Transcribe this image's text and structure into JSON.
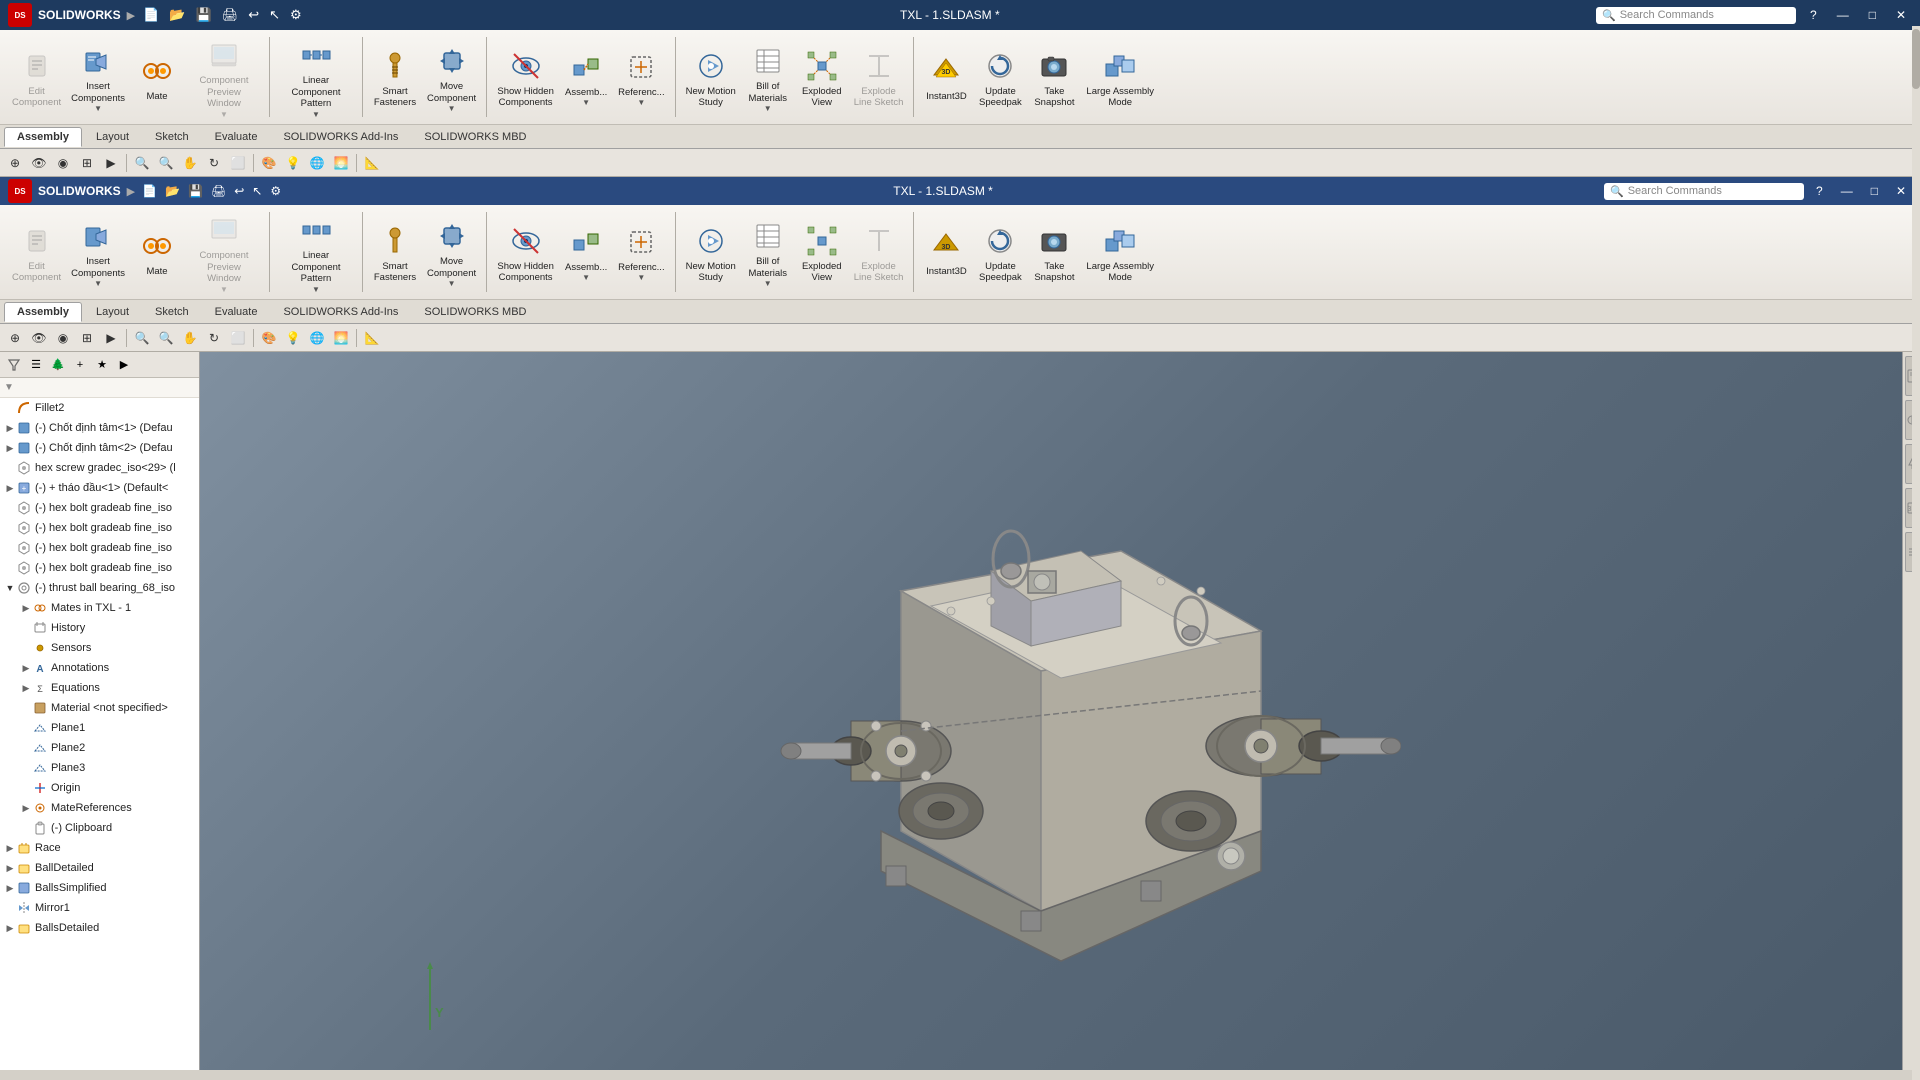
{
  "app": {
    "name": "SOLIDWORKS",
    "logo_text": "DS",
    "title": "TXL - 1.SLDASM *",
    "search_placeholder": "Search Commands",
    "window_controls": [
      "?",
      "—",
      "□",
      "✕"
    ]
  },
  "toolbar1": {
    "items": [
      {
        "id": "edit-component",
        "label": "Edit\nComponent",
        "icon": "edit",
        "disabled": true
      },
      {
        "id": "insert-components",
        "label": "Insert\nComponents",
        "icon": "insert",
        "disabled": false
      },
      {
        "id": "mate",
        "label": "Mate",
        "icon": "mate",
        "disabled": false
      },
      {
        "id": "component-preview",
        "label": "Component\nPreview Window",
        "icon": "preview",
        "disabled": true
      },
      {
        "id": "linear-pattern",
        "label": "Linear Component\nPattern",
        "icon": "pattern",
        "disabled": false
      },
      {
        "id": "smart-fasteners",
        "label": "Smart\nFasteners",
        "icon": "fastener",
        "disabled": false
      },
      {
        "id": "move-component",
        "label": "Move\nComponent",
        "icon": "move",
        "disabled": false
      },
      {
        "id": "show-hidden",
        "label": "Show Hidden\nComponents",
        "icon": "hidden",
        "disabled": false
      },
      {
        "id": "assembly",
        "label": "Assemb...",
        "icon": "assem",
        "disabled": false
      },
      {
        "id": "reference",
        "label": "Referenc...",
        "icon": "ref",
        "disabled": false
      },
      {
        "id": "new-motion-study",
        "label": "New Motion\nStudy",
        "icon": "motion",
        "disabled": false
      },
      {
        "id": "bill-of-materials",
        "label": "Bill of\nMaterials",
        "icon": "bom",
        "disabled": false
      },
      {
        "id": "exploded-view",
        "label": "Exploded\nView",
        "icon": "explode",
        "disabled": false
      },
      {
        "id": "explode-line",
        "label": "Explode\nLine Sketch",
        "icon": "explodeline",
        "disabled": true
      },
      {
        "id": "instant3d",
        "label": "Instant3D",
        "icon": "instant3d",
        "disabled": false
      },
      {
        "id": "update-speedpak",
        "label": "Update\nSpeedpak",
        "icon": "speedpak",
        "disabled": false
      },
      {
        "id": "take-snapshot",
        "label": "Take\nSnapshot",
        "icon": "snapshot",
        "disabled": false
      },
      {
        "id": "large-assembly",
        "label": "Large Assembly\nMode",
        "icon": "large",
        "disabled": false
      }
    ]
  },
  "tabs1": {
    "items": [
      {
        "id": "assembly-tab",
        "label": "Assembly",
        "active": true
      },
      {
        "id": "layout-tab",
        "label": "Layout",
        "active": false
      },
      {
        "id": "sketch-tab",
        "label": "Sketch",
        "active": false
      },
      {
        "id": "evaluate-tab",
        "label": "Evaluate",
        "active": false
      },
      {
        "id": "addins-tab",
        "label": "SOLIDWORKS Add-Ins",
        "active": false
      },
      {
        "id": "mbd-tab",
        "label": "SOLIDWORKS MBD",
        "active": false
      }
    ]
  },
  "tabs2": {
    "items": [
      {
        "id": "assembly-tab2",
        "label": "Assembly",
        "active": true
      },
      {
        "id": "layout-tab2",
        "label": "Layout",
        "active": false
      },
      {
        "id": "sketch-tab2",
        "label": "Sketch",
        "active": false
      },
      {
        "id": "evaluate-tab2",
        "label": "Evaluate",
        "active": false
      },
      {
        "id": "addins-tab2",
        "label": "SOLIDWORKS Add-Ins",
        "active": false
      },
      {
        "id": "mbd-tab2",
        "label": "SOLIDWORKS MBD",
        "active": false
      }
    ]
  },
  "feature_tree": {
    "items": [
      {
        "id": "fillet2",
        "label": "Fillet2",
        "level": 0,
        "icon": "fillet",
        "expand": false,
        "has_expand": false
      },
      {
        "id": "chot1",
        "label": "(-) Chốt định tâm<1> (Defau",
        "level": 0,
        "icon": "component",
        "expand": false,
        "has_expand": true
      },
      {
        "id": "chot2",
        "label": "(-) Chốt định tâm<2> (Defau",
        "level": 0,
        "icon": "component",
        "expand": false,
        "has_expand": true
      },
      {
        "id": "hex-screw",
        "label": "hex screw gradec_iso<29> (l",
        "level": 0,
        "icon": "component",
        "expand": false,
        "has_expand": false
      },
      {
        "id": "thao-dau",
        "label": "(-) + tháo đầu<1> (Default<",
        "level": 0,
        "icon": "component",
        "expand": false,
        "has_expand": true
      },
      {
        "id": "hex-bolt1",
        "label": "(-) hex bolt gradeab fine_iso",
        "level": 0,
        "icon": "component",
        "expand": false,
        "has_expand": false
      },
      {
        "id": "hex-bolt2",
        "label": "(-) hex bolt gradeab fine_iso",
        "level": 0,
        "icon": "component",
        "expand": false,
        "has_expand": false
      },
      {
        "id": "hex-bolt3",
        "label": "(-) hex bolt gradeab fine_iso",
        "level": 0,
        "icon": "component",
        "expand": false,
        "has_expand": false
      },
      {
        "id": "hex-bolt4",
        "label": "(-) hex bolt gradeab fine_iso",
        "level": 0,
        "icon": "component",
        "expand": false,
        "has_expand": false
      },
      {
        "id": "thrust-bearing",
        "label": "(-) thrust ball bearing_68_iso",
        "level": 0,
        "icon": "component",
        "expand": true,
        "has_expand": true
      },
      {
        "id": "mates",
        "label": "Mates in TXL - 1",
        "level": 1,
        "icon": "mates",
        "expand": false,
        "has_expand": true
      },
      {
        "id": "history",
        "label": "History",
        "level": 1,
        "icon": "history",
        "expand": false,
        "has_expand": false
      },
      {
        "id": "sensors",
        "label": "Sensors",
        "level": 1,
        "icon": "sensors",
        "expand": false,
        "has_expand": false
      },
      {
        "id": "annotations",
        "label": "Annotations",
        "level": 1,
        "icon": "annotations",
        "expand": false,
        "has_expand": true
      },
      {
        "id": "equations",
        "label": "Equations",
        "level": 1,
        "icon": "equations",
        "expand": false,
        "has_expand": true
      },
      {
        "id": "material",
        "label": "Material <not specified>",
        "level": 1,
        "icon": "material",
        "expand": false,
        "has_expand": false
      },
      {
        "id": "plane1",
        "label": "Plane1",
        "level": 1,
        "icon": "plane",
        "expand": false,
        "has_expand": false
      },
      {
        "id": "plane2",
        "label": "Plane2",
        "level": 1,
        "icon": "plane",
        "expand": false,
        "has_expand": false
      },
      {
        "id": "plane3",
        "label": "Plane3",
        "level": 1,
        "icon": "plane",
        "expand": false,
        "has_expand": false
      },
      {
        "id": "origin",
        "label": "Origin",
        "level": 1,
        "icon": "origin",
        "expand": false,
        "has_expand": false
      },
      {
        "id": "materef",
        "label": "MateReferences",
        "level": 1,
        "icon": "materef",
        "expand": false,
        "has_expand": true
      },
      {
        "id": "clipboard",
        "label": "(-) Clipboard",
        "level": 1,
        "icon": "clipboard",
        "expand": false,
        "has_expand": false
      },
      {
        "id": "race",
        "label": "Race",
        "level": 0,
        "icon": "folder",
        "expand": false,
        "has_expand": true
      },
      {
        "id": "ball-detailed",
        "label": "BallDetailed",
        "level": 0,
        "icon": "folder",
        "expand": false,
        "has_expand": true
      },
      {
        "id": "balls-simplified",
        "label": "BallsSimplified",
        "level": 0,
        "icon": "component",
        "expand": false,
        "has_expand": true
      },
      {
        "id": "mirror1",
        "label": "Mirror1",
        "level": 0,
        "icon": "mirror",
        "expand": false,
        "has_expand": false
      },
      {
        "id": "balls-detailed2",
        "label": "BallsDetailed",
        "level": 0,
        "icon": "folder",
        "expand": false,
        "has_expand": true
      }
    ]
  },
  "viewport": {
    "bg_color_top": "#7a8a9a",
    "bg_color_bottom": "#4a5a6a",
    "axis_label": "Y"
  },
  "right_panel_buttons": [
    "view1",
    "view2",
    "view3",
    "view4",
    "view5"
  ]
}
